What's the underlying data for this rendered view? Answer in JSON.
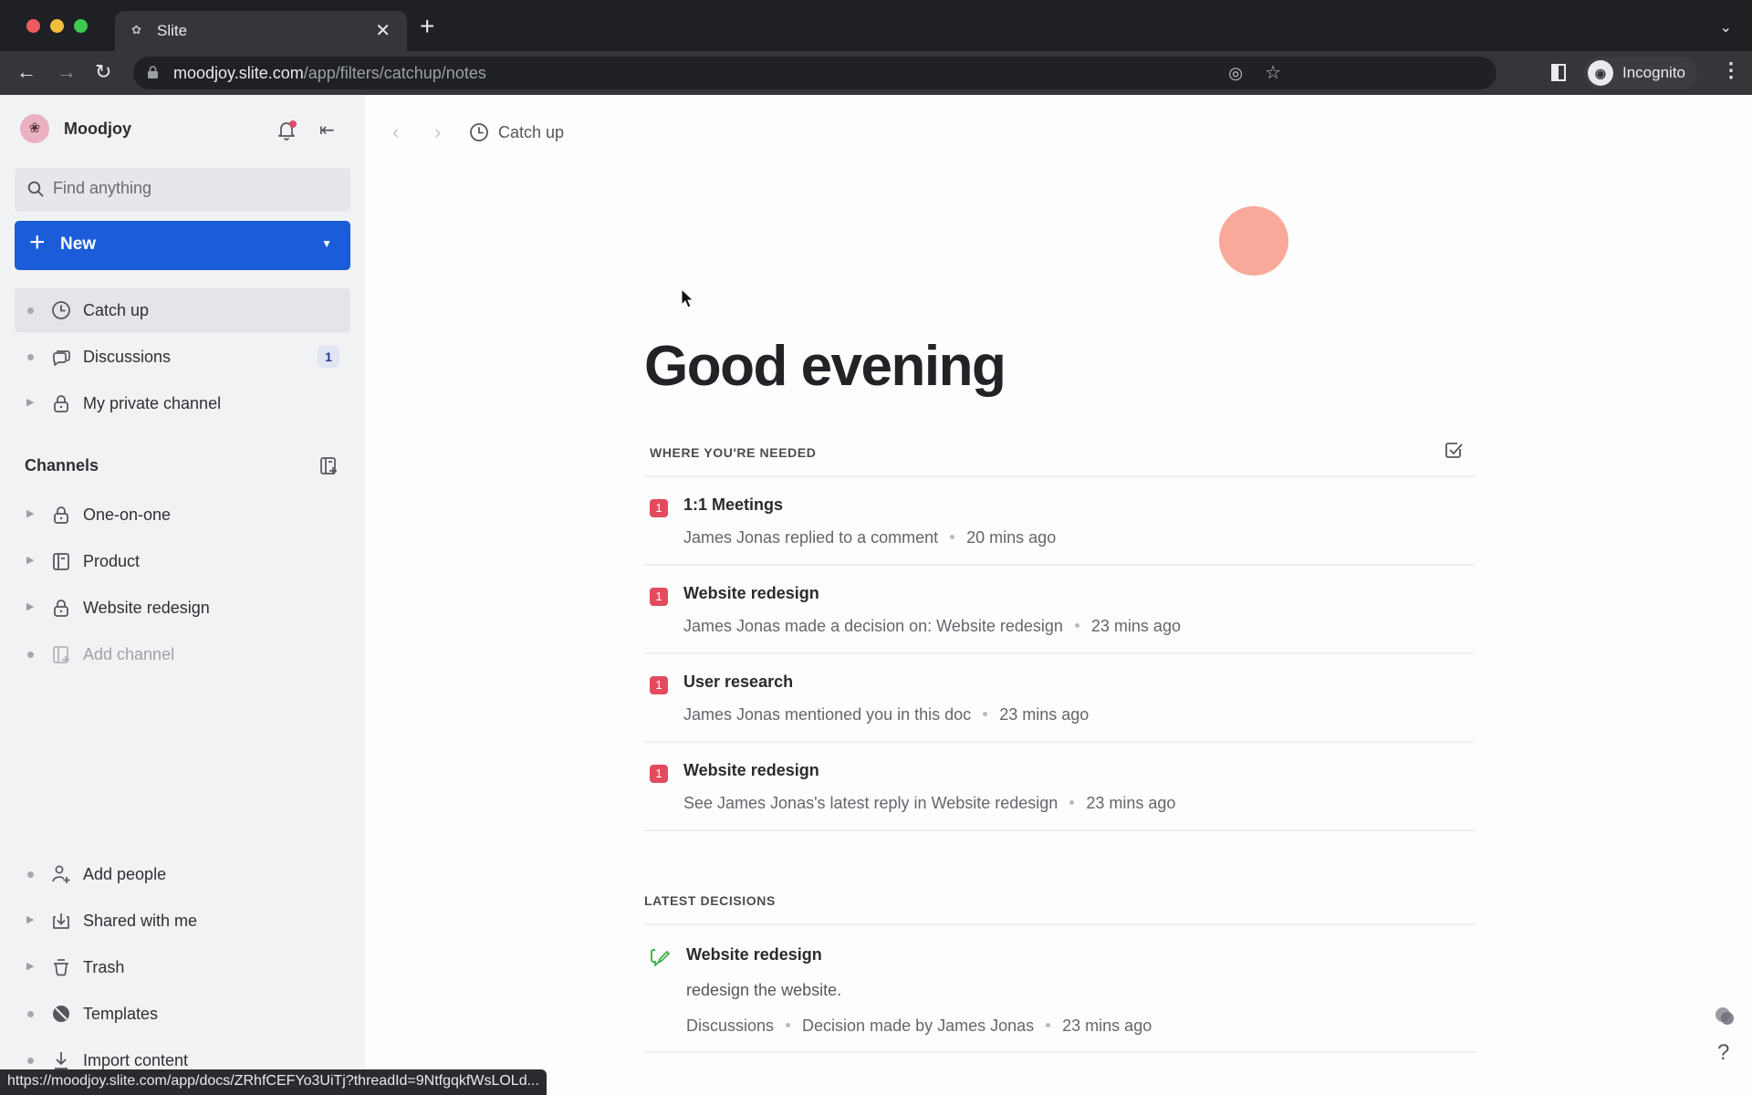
{
  "browser": {
    "tab_title": "Slite",
    "url_host": "moodjoy.slite.com",
    "url_path": "/app/filters/catchup/notes",
    "profile_label": "Incognito",
    "status_bar_url": "https://moodjoy.slite.com/app/docs/ZRhfCEFYo3UiTj?threadId=9NtfgqkfWsLOLd..."
  },
  "workspace": {
    "name": "Moodjoy",
    "search_placeholder": "Find anything",
    "new_label": "New"
  },
  "sidebar": {
    "top_items": [
      {
        "label": "Catch up",
        "icon": "clock-icon",
        "active": true
      },
      {
        "label": "Discussions",
        "icon": "chat-bubbles-icon",
        "count": "1"
      },
      {
        "label": "My private channel",
        "icon": "lock-icon"
      }
    ],
    "channels_heading": "Channels",
    "channels": [
      {
        "label": "One-on-one",
        "icon": "lock-icon"
      },
      {
        "label": "Product",
        "icon": "channel-icon"
      },
      {
        "label": "Website redesign",
        "icon": "lock-icon"
      },
      {
        "label": "Add channel",
        "icon": "add-channel-icon"
      }
    ],
    "bottom_items": [
      {
        "label": "Add people",
        "icon": "add-person-icon"
      },
      {
        "label": "Shared with me",
        "icon": "inbox-icon"
      },
      {
        "label": "Trash",
        "icon": "trash-icon"
      },
      {
        "label": "Templates",
        "icon": "templates-icon"
      },
      {
        "label": "Import content",
        "icon": "import-icon"
      }
    ]
  },
  "main": {
    "breadcrumb": "Catch up",
    "greeting": "Good evening",
    "needed": {
      "title": "WHERE YOU'RE NEEDED",
      "items": [
        {
          "badge": "1",
          "title": "1:1 Meetings",
          "text": "James Jonas replied to a comment",
          "time": "20 mins ago"
        },
        {
          "badge": "1",
          "title": "Website redesign",
          "text": "James Jonas made a decision on: Website redesign",
          "time": "23 mins ago"
        },
        {
          "badge": "1",
          "title": "User research",
          "text": "James Jonas mentioned you in this doc",
          "time": "23 mins ago"
        },
        {
          "badge": "1",
          "title": "Website redesign",
          "text": "See James Jonas's latest reply in Website redesign",
          "time": "23 mins ago"
        }
      ]
    },
    "decisions": {
      "title": "LATEST DECISIONS",
      "items": [
        {
          "title": "Website redesign",
          "body": "redesign the website.",
          "channel": "Discussions",
          "by": "Decision made by James Jonas",
          "time": "23 mins ago"
        }
      ]
    },
    "help_label": "?"
  },
  "colors": {
    "primary": "#1b5cd8",
    "badge_red": "#e34b5f",
    "decision_green": "#3bb34a",
    "avatar_blob": "#f8a99a"
  }
}
